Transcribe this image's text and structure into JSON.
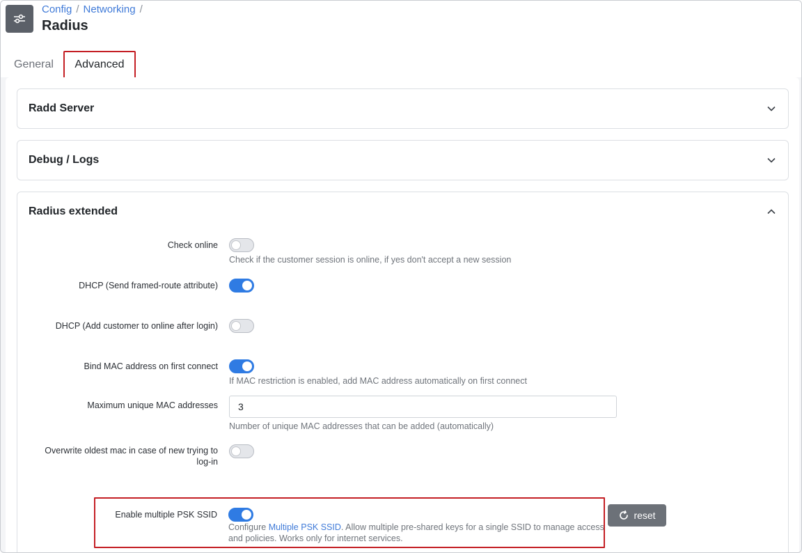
{
  "breadcrumb": {
    "items": [
      "Config",
      "Networking"
    ],
    "separator": "/"
  },
  "page": {
    "title": "Radius"
  },
  "tabs": [
    {
      "label": "General",
      "active": false
    },
    {
      "label": "Advanced",
      "active": true
    }
  ],
  "panels": {
    "radd_server": {
      "title": "Radd Server",
      "expanded": false
    },
    "debug_logs": {
      "title": "Debug / Logs",
      "expanded": false
    },
    "radius_extended": {
      "title": "Radius extended",
      "expanded": true
    }
  },
  "settings": {
    "check_online": {
      "label": "Check online",
      "enabled": false,
      "help": "Check if the customer session is online, if yes don't accept a new session"
    },
    "dhcp_framed_route": {
      "label": "DHCP (Send framed-route attribute)",
      "enabled": true
    },
    "dhcp_add_online": {
      "label": "DHCP (Add customer to online after login)",
      "enabled": false
    },
    "bind_mac": {
      "label": "Bind MAC address on first connect",
      "enabled": true,
      "help": "If MAC restriction is enabled, add MAC address automatically on first connect"
    },
    "max_mac": {
      "label": "Maximum unique MAC addresses",
      "value": "3",
      "help": "Number of unique MAC addresses that can be added (automatically)"
    },
    "overwrite_mac": {
      "label": "Overwrite oldest mac in case of new trying to log-in",
      "enabled": false
    },
    "multi_psk": {
      "label": "Enable multiple PSK SSID",
      "enabled": true,
      "help_prefix": "Configure ",
      "help_link": "Multiple PSK SSID",
      "help_suffix": ". Allow multiple pre-shared keys for a single SSID to manage access and policies. Works only for internet services.",
      "reset_label": "reset"
    }
  },
  "colors": {
    "accent": "#2f7be3",
    "link": "#3f7ad8",
    "highlight": "#c41e24",
    "reset_button": "#6c7178"
  }
}
